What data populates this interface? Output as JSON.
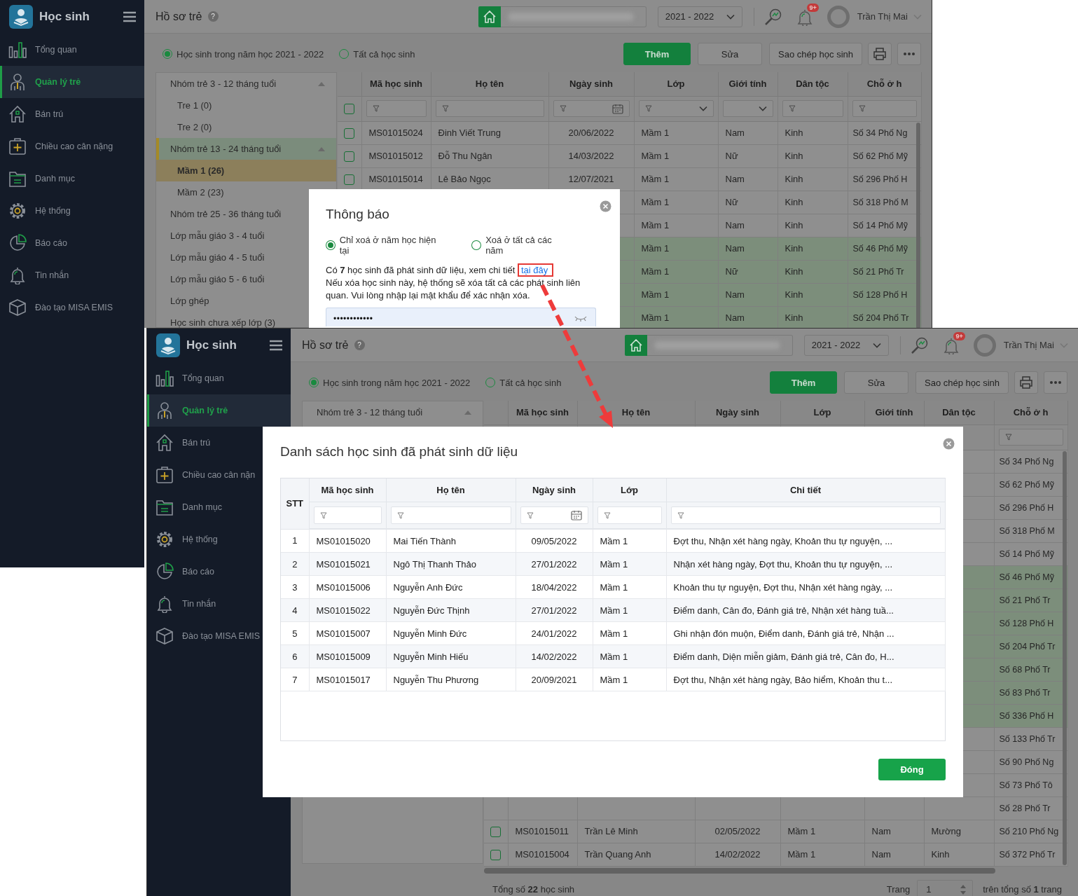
{
  "windows": [
    {
      "sidebar": {
        "app_title": "Học sinh",
        "items": [
          {
            "label": "Tổng quan",
            "selected": false
          },
          {
            "label": "Quản lý trẻ",
            "selected": true
          },
          {
            "label": "Bán trú",
            "selected": false
          },
          {
            "label": "Chiều cao cân nặng",
            "selected": false
          },
          {
            "label": "Danh mục",
            "selected": false
          },
          {
            "label": "Hệ thống",
            "selected": false
          },
          {
            "label": "Báo cáo",
            "selected": false
          },
          {
            "label": "Tin nhắn",
            "selected": false
          },
          {
            "label": "Đào tạo MISA EMIS",
            "selected": false
          }
        ]
      },
      "header": {
        "title": "Hồ sơ trẻ",
        "help": "?",
        "school_year": "2021 - 2022",
        "badge": "9+",
        "user_name": "Trần Thị Mai"
      },
      "filter_options": [
        {
          "label": "Học sinh trong năm học 2021 - 2022",
          "selected": true
        },
        {
          "label": "Tất cả học sinh",
          "selected": false
        }
      ],
      "toolbar": [
        {
          "label": "Thêm",
          "kind": "primary"
        },
        {
          "label": "Sửa",
          "kind": "secondary"
        },
        {
          "label": "Sao chép học sinh",
          "kind": "secondary"
        }
      ],
      "tree": [
        {
          "label": "Nhóm trẻ 3 - 12 tháng tuổi",
          "kind": "group",
          "expanded": true,
          "selected": false,
          "children": [
            {
              "label": "Tre 1 (0)",
              "selected": false
            },
            {
              "label": "Tre 2 (0)",
              "selected": false
            }
          ]
        },
        {
          "label": "Nhóm trẻ 13 - 24 tháng tuổi",
          "kind": "group",
          "expanded": true,
          "selected": true,
          "children": [
            {
              "label": "Mầm 1 (26)",
              "selected": true
            },
            {
              "label": "Mầm 2 (23)",
              "selected": false
            }
          ]
        },
        {
          "label": "Nhóm trẻ 25 - 36 tháng tuổi",
          "kind": "item",
          "selected": false
        },
        {
          "label": "Lớp mẫu giáo 3 - 4 tuổi",
          "kind": "item",
          "selected": false
        },
        {
          "label": "Lớp mẫu giáo 4 - 5 tuổi",
          "kind": "item",
          "selected": false
        },
        {
          "label": "Lớp mẫu giáo 5 - 6 tuổi",
          "kind": "item",
          "selected": false
        },
        {
          "label": "Lớp ghép",
          "kind": "item",
          "selected": false
        },
        {
          "label": "Học sinh chưa xếp lớp (3)",
          "kind": "item",
          "selected": false
        }
      ],
      "table": {
        "select_all_checked": false,
        "columns": [
          "Mã học sinh",
          "Họ tên",
          "Ngày sinh",
          "Lớp",
          "Giới tính",
          "Dân tộc",
          "Chỗ ở h"
        ],
        "rows": [
          {
            "selected": false,
            "ma_hoc_sinh": "MS01015024",
            "ho_ten": "Đinh Viết Trung",
            "ngay_sinh": "20/06/2022",
            "lop": "Mầm 1",
            "gioi_tinh": "Nam",
            "dan_toc": "Kinh",
            "cho_o": "Số 34 Phố Ng"
          },
          {
            "selected": false,
            "ma_hoc_sinh": "MS01015012",
            "ho_ten": "Đỗ Thu Ngân",
            "ngay_sinh": "14/03/2022",
            "lop": "Mầm 1",
            "gioi_tinh": "Nữ",
            "dan_toc": "Kinh",
            "cho_o": "Số 62 Phố Mỹ"
          },
          {
            "selected": false,
            "ma_hoc_sinh": "MS01015014",
            "ho_ten": "Lê Bảo Ngọc",
            "ngay_sinh": "12/07/2021",
            "lop": "Mầm 1",
            "gioi_tinh": "Nam",
            "dan_toc": "Kinh",
            "cho_o": "Số 296 Phố H"
          },
          {
            "selected": false,
            "lop": "Mầm 1",
            "gioi_tinh": "Nữ",
            "dan_toc": "Kinh",
            "cho_o": "Số 318 Phố M"
          },
          {
            "selected": false,
            "lop": "Mầm 1",
            "gioi_tinh": "Nam",
            "dan_toc": "Kinh",
            "cho_o": "Số 14 Phố Mỹ"
          },
          {
            "selected": true,
            "lop": "Mầm 1",
            "gioi_tinh": "Nam",
            "dan_toc": "Kinh",
            "cho_o": "Số 46 Phố Mỹ"
          },
          {
            "selected": true,
            "lop": "Mầm 1",
            "gioi_tinh": "Nữ",
            "dan_toc": "Kinh",
            "cho_o": "Số 21 Phố Tr"
          },
          {
            "selected": true,
            "lop": "Mầm 1",
            "gioi_tinh": "Nam",
            "dan_toc": "Kinh",
            "cho_o": "Số 128 Phố H"
          },
          {
            "selected": true,
            "lop": "Mầm 1",
            "gioi_tinh": "Nam",
            "dan_toc": "Kinh",
            "cho_o": "Số 204 Phố Tr"
          }
        ]
      },
      "dialog": {
        "kind": "confirm",
        "title": "Thông báo",
        "options": [
          {
            "label": "Chỉ xoá ở năm học hiện tại",
            "selected": true
          },
          {
            "label": "Xoá ở tất cả các năm",
            "selected": false
          }
        ],
        "message": "Có **7** học sinh đã phát sinh dữ liệu, xem chi tiết",
        "link": "tại đây",
        "warning": "Nếu xóa học sinh này, hệ thống sẽ xóa tất cả các phát sinh liên quan. Vui lòng nhập lại mật khẩu để xác nhận xóa.",
        "password": "••••••••••••"
      }
    },
    {
      "sidebar": {
        "app_title": "Học sinh",
        "items": [
          {
            "label": "Tổng quan",
            "selected": false
          },
          {
            "label": "Quản lý trẻ",
            "selected": true
          },
          {
            "label": "Bán trú",
            "selected": false
          },
          {
            "label": "Chiều cao cân nặn",
            "selected": false
          },
          {
            "label": "Danh mục",
            "selected": false
          },
          {
            "label": "Hệ thống",
            "selected": false
          },
          {
            "label": "Báo cáo",
            "selected": false
          },
          {
            "label": "Tin nhắn",
            "selected": false
          },
          {
            "label": "Đào tạo MISA EMIS",
            "selected": false
          }
        ]
      },
      "header": {
        "title": "Hồ sơ trẻ",
        "help": "?",
        "school_year": "2021 - 2022",
        "badge": "9+",
        "user_name": "Trần Thị Mai"
      },
      "filter_options": [
        {
          "label": "Học sinh trong năm học 2021 - 2022",
          "selected": true
        },
        {
          "label": "Tất cả học sinh",
          "selected": false
        }
      ],
      "toolbar": [
        {
          "label": "Thêm",
          "kind": "primary"
        },
        {
          "label": "Sửa",
          "kind": "secondary"
        },
        {
          "label": "Sao chép học sinh",
          "kind": "secondary"
        }
      ],
      "tree": [
        {
          "label": "Nhóm trẻ 3 - 12 tháng tuổi",
          "kind": "group",
          "expanded": true,
          "selected": false
        }
      ],
      "table": {
        "columns": [
          "Mã học sinh",
          "Họ tên",
          "Ngày sinh",
          "Lớp",
          "Giới tính",
          "Dân tộc",
          "Chỗ ở h"
        ],
        "rows": [
          {
            "selected": false,
            "cho_o": "Số 34 Phố Ng"
          },
          {
            "selected": false,
            "cho_o": "Số 62 Phố Mỹ"
          },
          {
            "selected": false,
            "cho_o": "Số 296 Phố H"
          },
          {
            "selected": false,
            "cho_o": "Số 318 Phố M"
          },
          {
            "selected": false,
            "cho_o": "Số 14 Phố Mỹ"
          },
          {
            "selected": true,
            "cho_o": "Số 46 Phố Mỹ"
          },
          {
            "selected": true,
            "cho_o": "Số 21 Phố Tr"
          },
          {
            "selected": true,
            "cho_o": "Số 128 Phố H"
          },
          {
            "selected": true,
            "cho_o": "Số 204 Phố Tr"
          },
          {
            "selected": true,
            "cho_o": "Số 68 Phố Tr"
          },
          {
            "selected": true,
            "cho_o": "Số 83 Phố Tr"
          },
          {
            "selected": true,
            "cho_o": "Số 336 Phố H"
          },
          {
            "selected": false,
            "cho_o": "Số 133 Phố Tr"
          },
          {
            "selected": false,
            "cho_o": "Số 90 Phố Ng"
          },
          {
            "selected": false,
            "cho_o": "Số 73 Phố Tô"
          },
          {
            "selected": false,
            "cho_o": "Số 28 Phố Tr"
          },
          {
            "selected": false,
            "ma_hoc_sinh": "MS01015011",
            "ho_ten": "Trần Lê Minh",
            "ngay_sinh": "02/05/2022",
            "lop": "Mầm 1",
            "gioi_tinh": "Nam",
            "dan_toc": "Mường",
            "cho_o": "Số 210 Phố Ng"
          },
          {
            "selected": false,
            "ma_hoc_sinh": "MS01015004",
            "ho_ten": "Trần Quang Anh",
            "ngay_sinh": "14/02/2022",
            "lop": "Mầm 1",
            "gioi_tinh": "Nam",
            "dan_toc": "Kinh",
            "cho_o": "Số 372 Phố Tr"
          }
        ]
      },
      "footer": {
        "total": "Tổng số **22** học sinh",
        "page_label": "Trang",
        "page": "1",
        "page_total": "trên tổng số **1** trang"
      },
      "dialog": {
        "kind": "list",
        "title": "Danh sách học sinh đã phát sinh dữ liệu",
        "columns": [
          "STT",
          "Mã học sinh",
          "Họ tên",
          "Ngày sinh",
          "Lớp",
          "Chi tiết"
        ],
        "rows": [
          {
            "stt": "1",
            "ma_hoc_sinh": "MS01015020",
            "ho_ten": "Mai Tiến Thành",
            "ngay_sinh": "09/05/2022",
            "lop": "Mầm 1",
            "chi_tiet": "Đợt thu, Nhận xét hàng ngày, Khoản thu tự nguyện, ..."
          },
          {
            "stt": "2",
            "ma_hoc_sinh": "MS01015021",
            "ho_ten": "Ngô Thị Thanh Thảo",
            "ngay_sinh": "27/01/2022",
            "lop": "Mầm 1",
            "chi_tiet": "Nhận xét hàng ngày, Đợt thu, Khoản thu tự nguyện, ..."
          },
          {
            "stt": "3",
            "ma_hoc_sinh": "MS01015006",
            "ho_ten": "Nguyễn Anh Đức",
            "ngay_sinh": "18/04/2022",
            "lop": "Mầm 1",
            "chi_tiet": "Khoản thu tự nguyện, Đợt thu, Nhận xét hàng ngày, ..."
          },
          {
            "stt": "4",
            "ma_hoc_sinh": "MS01015022",
            "ho_ten": "Nguyễn Đức Thịnh",
            "ngay_sinh": "27/01/2022",
            "lop": "Mầm 1",
            "chi_tiet": "Điểm danh, Cân đo, Đánh giá trẻ, Nhận xét hàng tuầ..."
          },
          {
            "stt": "5",
            "ma_hoc_sinh": "MS01015007",
            "ho_ten": "Nguyễn Minh Đức",
            "ngay_sinh": "24/01/2022",
            "lop": "Mầm 1",
            "chi_tiet": "Ghi nhận đón muộn, Điểm danh, Đánh giá trẻ, Nhận ..."
          },
          {
            "stt": "6",
            "ma_hoc_sinh": "MS01015009",
            "ho_ten": "Nguyễn Minh Hiếu",
            "ngay_sinh": "14/02/2022",
            "lop": "Mầm 1",
            "chi_tiet": "Điểm danh, Diện miễn giảm, Đánh giá trẻ, Cân đo, H..."
          },
          {
            "stt": "7",
            "ma_hoc_sinh": "MS01015017",
            "ho_ten": "Nguyễn Thu Phương",
            "ngay_sinh": "20/09/2021",
            "lop": "Mầm 1",
            "chi_tiet": "Đợt thu, Nhận xét hàng ngày, Bảo hiểm, Khoản thu t..."
          }
        ],
        "button": "Đóng"
      }
    }
  ]
}
